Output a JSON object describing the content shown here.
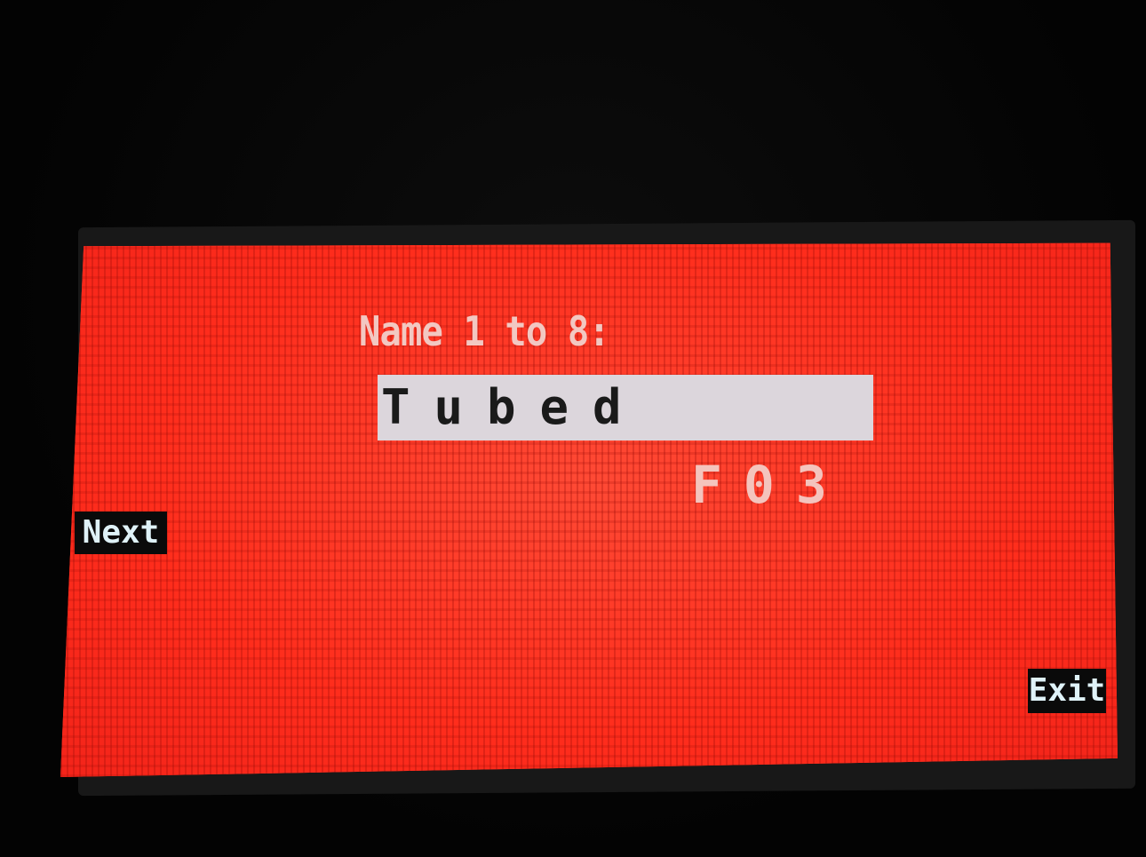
{
  "screen": {
    "prompt_label": "Name 1 to 8:",
    "name_value": "Tubed",
    "slot_code": "F03"
  },
  "softkeys": {
    "next_label": "Next",
    "exit_label": "Exit"
  },
  "colors": {
    "lcd_background": "#ff3322",
    "field_background": "#dcd6dc",
    "field_text": "#1a1a1a",
    "label_text": "#f2c8c2",
    "softkey_background": "#0a0a0a",
    "softkey_text": "#dff2f8"
  }
}
